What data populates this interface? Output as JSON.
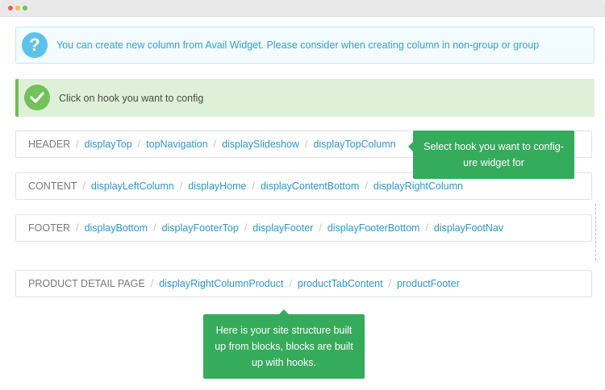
{
  "window": {
    "controls": [
      "close",
      "minimize",
      "maximize"
    ]
  },
  "info_alert": {
    "icon": "question-circle-icon",
    "text": "You can create new column from Avail Widget. Please consider when creating column in non-group or group"
  },
  "success_alert": {
    "icon": "check-circle-icon",
    "text": "Click on hook you want to config"
  },
  "sections": {
    "header": {
      "label": "HEADER",
      "hooks": [
        "displayTop",
        "topNavigation",
        "displaySlideshow",
        "displayTopColumn"
      ]
    },
    "content": {
      "label": "CONTENT",
      "hooks": [
        "displayLeftColumn",
        "displayHome",
        "displayContentBottom",
        "displayRightColumn"
      ]
    },
    "footer": {
      "label": "FOOTER",
      "hooks": [
        "displayBottom",
        "displayFooterTop",
        "displayFooter",
        "displayFooterBottom",
        "displayFootNav"
      ]
    },
    "product": {
      "label": "PRODUCT DETAIL PAGE",
      "hooks": [
        "displayRightColumnProduct",
        "productTabContent",
        "productFooter"
      ]
    }
  },
  "separator": "/",
  "tooltips": {
    "select_hook": {
      "line1": "Select hook you want to config-",
      "line2": "ure widget for"
    },
    "site_structure": {
      "line1": "Here is your site structure built",
      "line2": "up from blocks, blocks are built",
      "line3": "up with hooks."
    }
  },
  "colors": {
    "link": "#2e96c9",
    "tooltip": "#35ab5c",
    "info_border": "#c4e7f5",
    "success_bg": "#dff0d8"
  }
}
